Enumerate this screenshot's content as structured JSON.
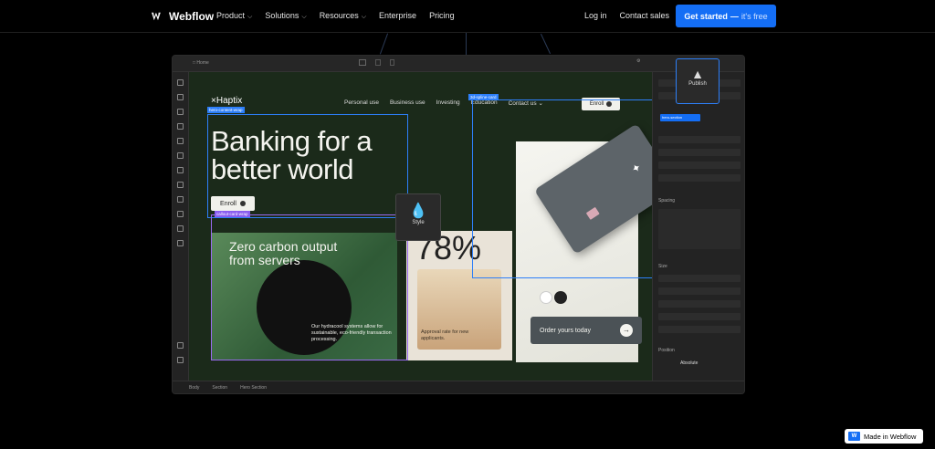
{
  "nav": {
    "logo_text": "Webflow",
    "links": [
      {
        "label": "Product",
        "has_dropdown": true
      },
      {
        "label": "Solutions",
        "has_dropdown": true
      },
      {
        "label": "Resources",
        "has_dropdown": true
      },
      {
        "label": "Enterprise",
        "has_dropdown": false
      },
      {
        "label": "Pricing",
        "has_dropdown": false
      }
    ],
    "login": "Log in",
    "contact": "Contact sales",
    "cta_main": "Get started",
    "cta_sep": "—",
    "cta_free": "it's free"
  },
  "designer": {
    "page_label": "Home",
    "bottom_bar": [
      "Body",
      "Section",
      "Hero Section"
    ],
    "publish_label": "Publish",
    "style_label": "Style",
    "selections": {
      "hero_wrap": "hero-content-wrap",
      "callout_wrap": "callout-card-wrap",
      "card_wrap": "3d-spline-card"
    },
    "panel": {
      "sections": [
        "Spacing",
        "Size",
        "Position"
      ],
      "selected_class": "hero-section",
      "position_value": "Absolute"
    }
  },
  "site": {
    "brand": "Haptix",
    "nav": [
      "Personal use",
      "Business use",
      "Investing",
      "Education",
      "Contact us"
    ],
    "enroll_top": "Enroll",
    "headline_line1": "Banking for a",
    "headline_line2": "better world",
    "enroll_main": "Enroll",
    "green_title": "Zero carbon output from servers",
    "green_body": "Our hydracool systems allow for sustainable, eco-friendly transaction processing.",
    "tan_value": "78%",
    "tan_caption": "Approval rate for new applicants.",
    "order_label": "Order yours today"
  },
  "badge": {
    "label": "Made in Webflow"
  },
  "colors": {
    "accent": "#146ef5",
    "selection": "#2d7ff9",
    "selection_purple": "#8a5cf0"
  }
}
